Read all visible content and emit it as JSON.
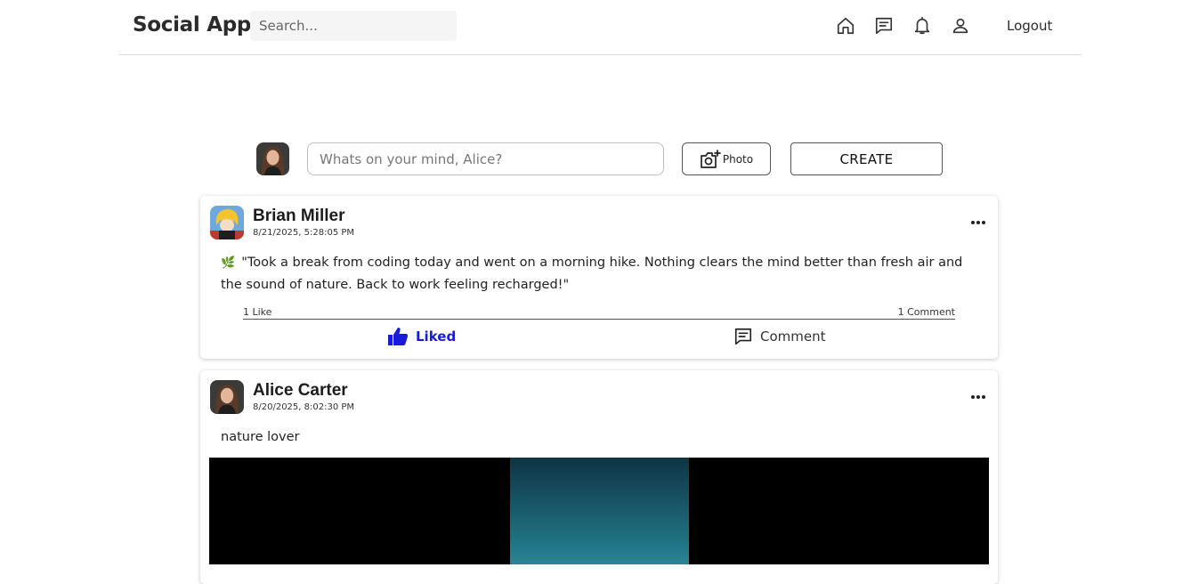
{
  "header": {
    "brand": "Social App",
    "search_placeholder": "Search...",
    "logout_label": "Logout"
  },
  "composer": {
    "placeholder": "Whats on your mind, Alice?",
    "photo_label": "Photo",
    "create_label": "CREATE"
  },
  "posts": [
    {
      "author": "Brian Miller",
      "timestamp": "8/21/2025, 5:28:05 PM",
      "text": "\"Took a break from coding today and went on a morning hike. Nothing clears the mind better than fresh air and the sound of nature. Back to work feeling recharged!\"",
      "leaf_emoji": "🌿",
      "likes_label": "1 Like",
      "comments_label": "1 Comment",
      "like_action_label": "Liked",
      "comment_action_label": "Comment"
    },
    {
      "author": "Alice Carter",
      "timestamp": "8/20/2025, 8:02:30 PM",
      "text": "nature lover"
    }
  ],
  "colors": {
    "liked": "#1a1adb",
    "divider": "#dcdcdc"
  }
}
